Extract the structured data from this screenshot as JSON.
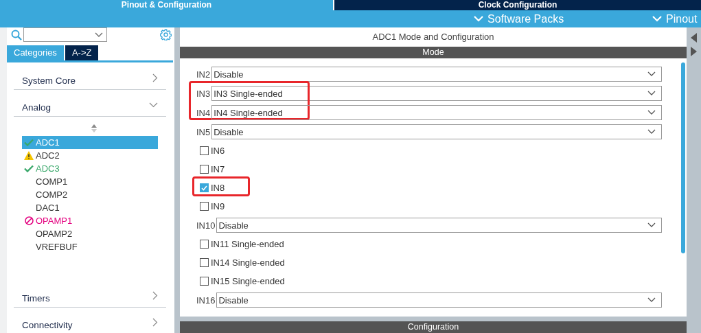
{
  "top_tabs": [
    {
      "label": "Pinout & Configuration",
      "selected": true
    },
    {
      "label": "Clock Configuration",
      "selected": false
    }
  ],
  "menu": [
    "Software Packs",
    "Pinout"
  ],
  "sidebar": {
    "tabs": [
      {
        "label": "Categories",
        "selected": true
      },
      {
        "label": "A->Z",
        "selected": false
      }
    ],
    "categories": [
      {
        "label": "System Core",
        "expanded": false
      },
      {
        "label": "Analog",
        "expanded": true,
        "items": [
          {
            "label": "ADC1",
            "kind": "ok",
            "selected": true
          },
          {
            "label": "ADC2",
            "kind": "warning",
            "selected": false
          },
          {
            "label": "ADC3",
            "kind": "ok",
            "selected": false
          },
          {
            "label": "COMP1",
            "kind": "plain",
            "selected": false
          },
          {
            "label": "COMP2",
            "kind": "plain",
            "selected": false
          },
          {
            "label": "DAC1",
            "kind": "plain",
            "selected": false
          },
          {
            "label": "OPAMP1",
            "kind": "blocked",
            "selected": false
          },
          {
            "label": "OPAMP2",
            "kind": "plain",
            "selected": false
          },
          {
            "label": "VREFBUF",
            "kind": "plain",
            "selected": false
          }
        ]
      },
      {
        "label": "Timers",
        "expanded": false
      },
      {
        "label": "Connectivity",
        "expanded": false
      }
    ]
  },
  "panel": {
    "title": "ADC1 Mode and Configuration",
    "mode_header": "Mode",
    "rows": [
      {
        "kind": "select",
        "label": "IN2",
        "value": "Disable",
        "highlighted": false
      },
      {
        "kind": "select",
        "label": "IN3",
        "value": "IN3 Single-ended",
        "highlighted": true
      },
      {
        "kind": "select",
        "label": "IN4",
        "value": "IN4 Single-ended",
        "highlighted": true
      },
      {
        "kind": "select",
        "label": "IN5",
        "value": "Disable",
        "highlighted": false
      },
      {
        "kind": "checkbox",
        "label": "IN6",
        "checked": false,
        "highlighted": false
      },
      {
        "kind": "checkbox",
        "label": "IN7",
        "checked": false,
        "highlighted": false
      },
      {
        "kind": "checkbox",
        "label": "IN8",
        "checked": true,
        "highlighted": true
      },
      {
        "kind": "checkbox",
        "label": "IN9",
        "checked": false,
        "highlighted": false
      },
      {
        "kind": "select",
        "label": "IN10",
        "value": "Disable",
        "highlighted": false
      },
      {
        "kind": "checkbox",
        "label": "IN11 Single-ended",
        "checked": false,
        "highlighted": false
      },
      {
        "kind": "checkbox",
        "label": "IN14 Single-ended",
        "checked": false,
        "highlighted": false
      },
      {
        "kind": "checkbox",
        "label": "IN15 Single-ended",
        "checked": false,
        "highlighted": false
      },
      {
        "kind": "select",
        "label": "IN16",
        "value": "Disable",
        "highlighted": false
      }
    ],
    "config_header": "Configuration"
  }
}
